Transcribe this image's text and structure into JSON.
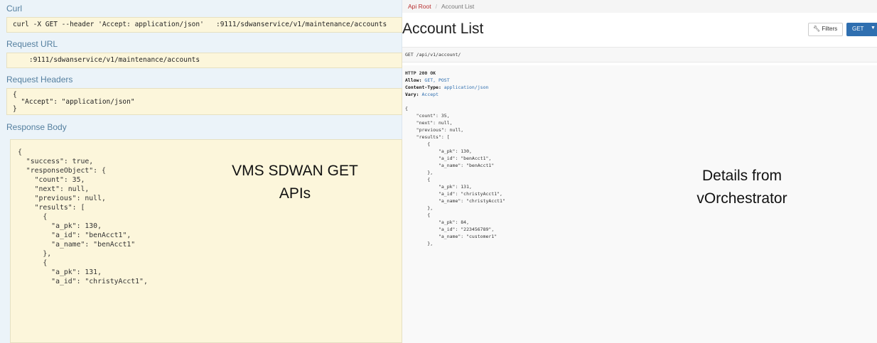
{
  "left": {
    "curl": {
      "title": "Curl",
      "command": "curl -X GET --header 'Accept: application/json'   :9111/sdwanservice/v1/maintenance/accounts"
    },
    "request_url": {
      "title": "Request URL",
      "value": "    :9111/sdwanservice/v1/maintenance/accounts"
    },
    "request_headers": {
      "title": "Request Headers",
      "lines": [
        "{",
        "  \"Accept\": \"application/json\"",
        "}"
      ]
    },
    "response_body": {
      "title": "Response Body",
      "lines": [
        "{",
        "  \"success\": true,",
        "  \"responseObject\": {",
        "    \"count\": 35,",
        "    \"next\": null,",
        "    \"previous\": null,",
        "    \"results\": [",
        "      {",
        "        \"a_pk\": 130,",
        "        \"a_id\": \"benAcct1\",",
        "        \"a_name\": \"benAcct1\"",
        "      },",
        "      {",
        "        \"a_pk\": 131,",
        "        \"a_id\": \"christyAcct1\","
      ]
    },
    "overlay": {
      "line1": "VMS SDWAN GET",
      "line2": "APIs"
    }
  },
  "right": {
    "breadcrumb": {
      "root": "Api Root",
      "current": "Account List"
    },
    "title": "Account List",
    "filters_label": "Filters",
    "get_label": "GET",
    "request_line": "GET /api/v1/account/",
    "status_line": "HTTP 200 OK",
    "headers": [
      {
        "name": "Allow:",
        "value": "GET, POST"
      },
      {
        "name": "Content-Type:",
        "value": "application/json"
      },
      {
        "name": "Vary:",
        "value": "Accept"
      }
    ],
    "body_lines": [
      "{",
      "    \"count\": 35,",
      "    \"next\": null,",
      "    \"previous\": null,",
      "    \"results\": [",
      "        {",
      "            \"a_pk\": 130,",
      "            \"a_id\": \"benAcct1\",",
      "            \"a_name\": \"benAcct1\"",
      "        },",
      "        {",
      "            \"a_pk\": 131,",
      "            \"a_id\": \"christyAcct1\",",
      "            \"a_name\": \"christyAcct1\"",
      "        },",
      "        {",
      "            \"a_pk\": 84,",
      "            \"a_id\": \"223456789\",",
      "            \"a_name\": \"customer1\"",
      "        },"
    ],
    "overlay": {
      "line1": "Details from",
      "line2": "vOrchestrator"
    }
  },
  "colors": {
    "accent_blue": "#2f6fb0",
    "link_red": "#b72e2e",
    "code_bg": "#fcf6db",
    "panel_bg": "#ebf3f9"
  }
}
